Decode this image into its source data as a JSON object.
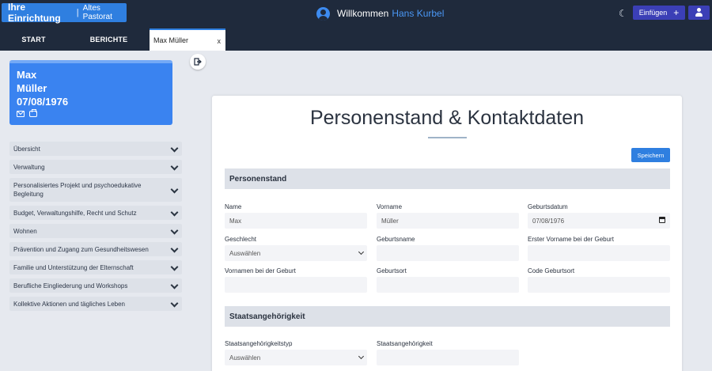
{
  "header": {
    "brand_title": "Ihre Einrichtung",
    "brand_separator": "|",
    "brand_subtitle": "Altes Pastorat",
    "welcome_text": "Willkommen",
    "user_name": "Hans Kurbel",
    "insert_label": "Einfügen",
    "insert_plus": "+",
    "theme_icon": "moon-icon",
    "moon_glyph": "☾"
  },
  "tabs": {
    "start": "START",
    "berichte": "BERICHTE",
    "active": "Max Müller",
    "close": "x"
  },
  "person": {
    "first_name": "Max",
    "last_name": "Müller",
    "birth_date": "07/08/1976"
  },
  "menu": [
    "Übersicht",
    "Verwaltung",
    "Personalisiertes Projekt und psychoedukative Begleitung",
    "Budget, Verwaltungshilfe, Recht und Schutz",
    "Wohnen",
    "Prävention und Zugang zum Gesundheitswesen",
    "Familie und Unterstützung der Elternschaft",
    "Berufliche Eingliederung und Workshops",
    "Kollektive Aktionen und tägliches Leben"
  ],
  "form": {
    "title": "Personenstand & Kontaktdaten",
    "save_label": "Speichern",
    "section1": "Personenstand",
    "section2": "Staatsangehörigkeit",
    "fields": {
      "name": {
        "label": "Name",
        "value": "Max"
      },
      "vorname": {
        "label": "Vorname",
        "value": "Müller"
      },
      "geburtsdatum": {
        "label": "Geburtsdatum",
        "value": "07/08/1976"
      },
      "geschlecht": {
        "label": "Geschlecht",
        "value": "Auswählen"
      },
      "geburtsname": {
        "label": "Geburtsname",
        "value": ""
      },
      "erster_vorname": {
        "label": "Erster Vorname bei der Geburt",
        "value": ""
      },
      "vornamen_geburt": {
        "label": "Vornamen bei der Geburt",
        "value": ""
      },
      "geburtsort": {
        "label": "Geburtsort",
        "value": ""
      },
      "code_geburtsort": {
        "label": "Code Geburtsort",
        "value": ""
      },
      "staatsangehoerigkeitstyp": {
        "label": "Staatsangehörigkeitstyp",
        "value": "Auswählen"
      },
      "staatsangehoerigkeit": {
        "label": "Staatsangehörigkeit",
        "value": ""
      }
    }
  },
  "colors": {
    "navbar": "#1f2a3c",
    "brand": "#2f7fe0",
    "accent_button": "#3b3fb6",
    "card": "#3a83f0",
    "section_bg": "#dde1e8",
    "page_bg": "#e6e9ef"
  }
}
